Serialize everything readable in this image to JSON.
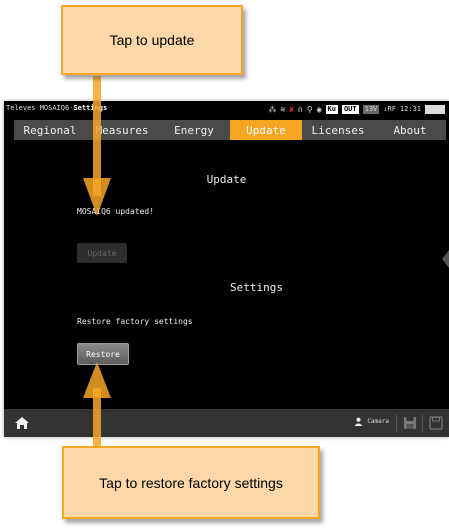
{
  "statusbar": {
    "title_prefix": "Televes MOSAIQ6-",
    "title_section": "Settings",
    "icons": [
      "network-icon",
      "wifi-icon",
      "satellite-dish-icon",
      "headphones-icon",
      "lnb-icon",
      "power-circle-icon"
    ],
    "badges": {
      "band": "Ku",
      "out": "OUT",
      "voltage": "13V"
    },
    "rf": "↓RF",
    "time": "12:31"
  },
  "tabs": [
    {
      "label": "Regional"
    },
    {
      "label": "Measures"
    },
    {
      "label": "Energy"
    },
    {
      "label": "Update",
      "active": true
    },
    {
      "label": "Licenses"
    },
    {
      "label": "About"
    }
  ],
  "update_section": {
    "title": "Update",
    "message": "MOSAIQ6 updated!",
    "button_label": "Update"
  },
  "settings_section": {
    "title": "Settings",
    "message": "Restore factory settings",
    "button_label": "Restore"
  },
  "bottombar": {
    "user_label": "Camara"
  },
  "callouts": {
    "top": "Tap to update",
    "bottom": "Tap to restore factory settings"
  },
  "colors": {
    "accent": "#f6a623",
    "callout_fill": "#fcd8a8",
    "screen_bg": "#000000",
    "tabbar_bg": "#4a4a4a"
  }
}
